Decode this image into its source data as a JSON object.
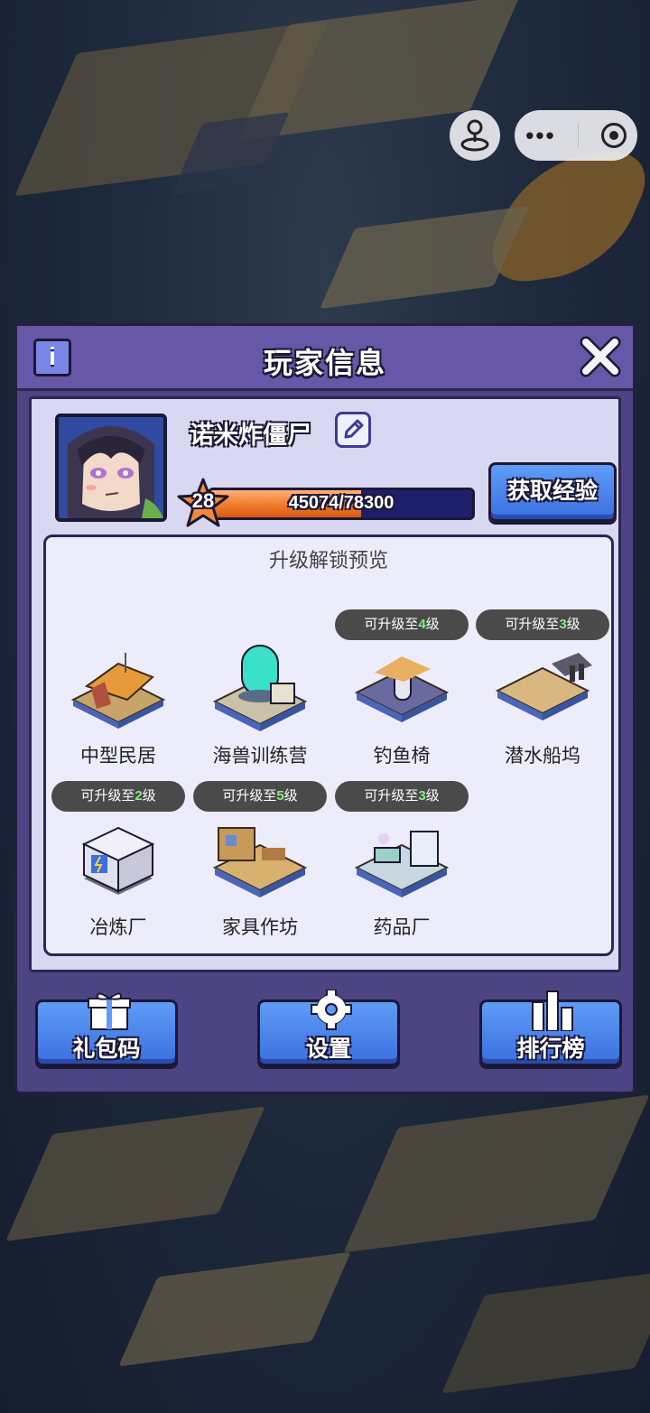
{
  "panel": {
    "title": "玩家信息",
    "info_icon": "i"
  },
  "player": {
    "nickname": "诺米炸僵尸",
    "level": "28",
    "xp_text": "45074/78300",
    "xp_fraction": 0.5757
  },
  "actions": {
    "get_xp": "获取经验"
  },
  "preview": {
    "title": "升级解锁预览",
    "buildings": [
      {
        "name": "中型民居",
        "badge_prefix": "",
        "badge_level": "",
        "badge_suffix": ""
      },
      {
        "name": "海兽训练营",
        "badge_prefix": "",
        "badge_level": "",
        "badge_suffix": ""
      },
      {
        "name": "钓鱼椅",
        "badge_prefix": "可升级至",
        "badge_level": "4",
        "badge_suffix": "级"
      },
      {
        "name": "潜水船坞",
        "badge_prefix": "可升级至",
        "badge_level": "3",
        "badge_suffix": "级"
      },
      {
        "name": "冶炼厂",
        "badge_prefix": "可升级至",
        "badge_level": "2",
        "badge_suffix": "级"
      },
      {
        "name": "家具作坊",
        "badge_prefix": "可升级至",
        "badge_level": "5",
        "badge_suffix": "级"
      },
      {
        "name": "药品厂",
        "badge_prefix": "可升级至",
        "badge_level": "3",
        "badge_suffix": "级"
      }
    ]
  },
  "bottom": {
    "gift_code": "礼包码",
    "settings": "设置",
    "leaderboard": "排行榜"
  },
  "icons": {
    "gift": "gift-icon",
    "settings": "gear-icon",
    "leaderboard": "bar-chart-icon",
    "close": "close-icon",
    "edit": "pencil-icon",
    "star": "star-icon"
  },
  "colors": {
    "panel": "#4d4484",
    "header": "#6657a8",
    "button_blue": "#3b6fe0",
    "xp_fill": "#f07a2a",
    "level_badge": "#7cf27c"
  }
}
